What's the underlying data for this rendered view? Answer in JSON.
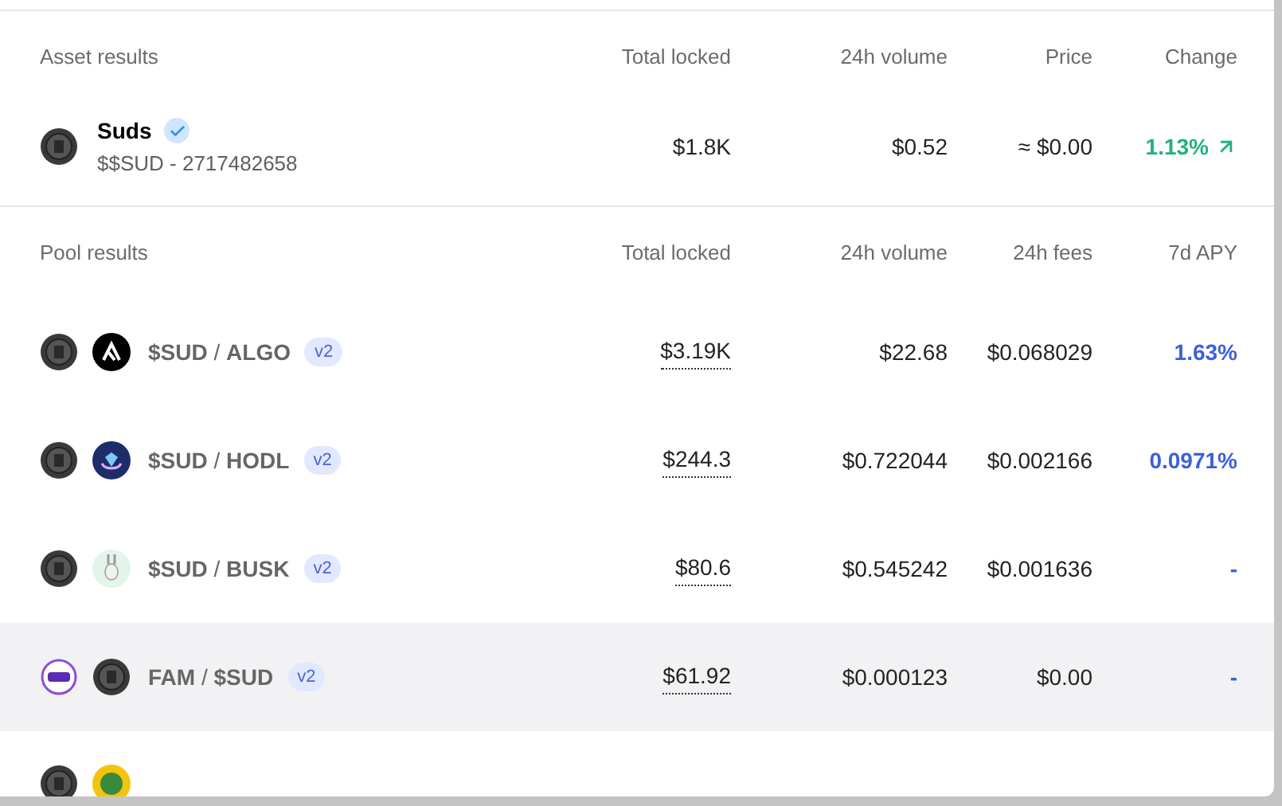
{
  "asset_results": {
    "columns": [
      "Asset results",
      "Total locked",
      "24h volume",
      "Price",
      "Change"
    ],
    "rows": [
      {
        "name": "Suds",
        "verified": true,
        "subtitle": "$$SUD - 2717482658",
        "total_locked": "$1.8K",
        "volume_24h": "$0.52",
        "price": "≈ $0.00",
        "change": "1.13%"
      }
    ]
  },
  "pool_results": {
    "columns": [
      "Pool results",
      "Total locked",
      "24h volume",
      "24h fees",
      "7d APY"
    ],
    "rows": [
      {
        "pair": "**$SUD** / **ALGO**",
        "version": "v2",
        "total_locked": "$3.19K",
        "volume_24h": "$22.68",
        "fees_24h": "$0.068029",
        "apy": "1.63%",
        "selected": false
      },
      {
        "pair": "**$SUD** / **HODL**",
        "version": "v2",
        "total_locked": "$244.3",
        "volume_24h": "$0.722044",
        "fees_24h": "$0.002166",
        "apy": "0.0971%",
        "selected": false
      },
      {
        "pair": "**$SUD** / **BUSK**",
        "version": "v2",
        "total_locked": "$80.6",
        "volume_24h": "$0.545242",
        "fees_24h": "$0.001636",
        "apy": "-",
        "selected": false
      },
      {
        "pair": "**FAM** / **$SUD**",
        "version": "v2",
        "total_locked": "$61.92",
        "volume_24h": "$0.000123",
        "fees_24h": "$0.00",
        "apy": "-",
        "selected": true
      }
    ]
  }
}
